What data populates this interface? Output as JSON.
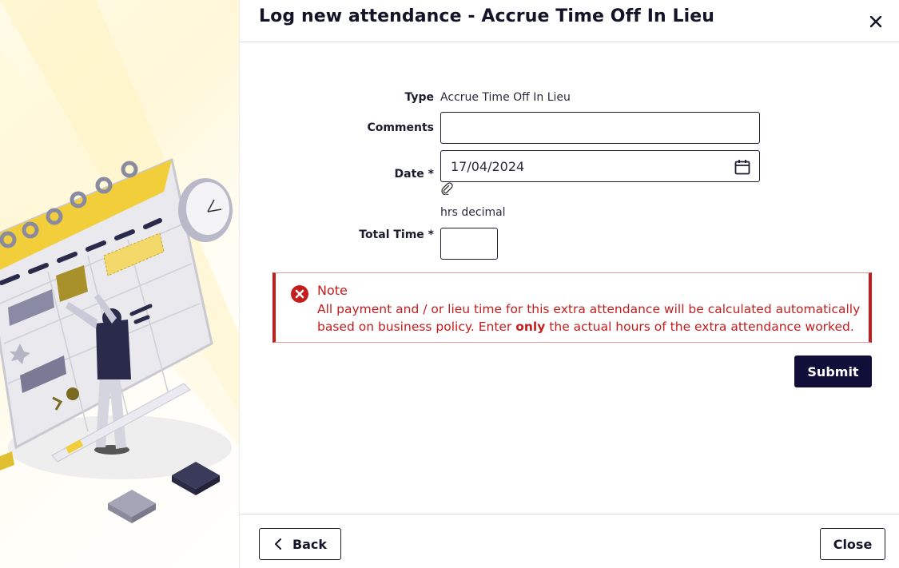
{
  "dialog": {
    "title": "Log new attendance - Accrue Time Off In Lieu"
  },
  "form": {
    "type_label": "Type",
    "type_value": "Accrue Time Off In Lieu",
    "comments_label": "Comments",
    "comments_value": "",
    "date_label": "Date *",
    "date_value": "17/04/2024",
    "unit_hint": "hrs decimal",
    "total_time_label": "Total Time *",
    "total_time_value": ""
  },
  "note": {
    "title": "Note",
    "text_before": "All payment and / or lieu time for this extra attendance will be calculated automatically based on business policy. Enter ",
    "text_bold": "only",
    "text_after": " the actual hours of the extra attendance worked."
  },
  "actions": {
    "submit_label": "Submit",
    "back_label": "Back",
    "close_label": "Close"
  },
  "icons": {
    "close": "close-icon",
    "calendar": "calendar-icon",
    "attachment": "paperclip-icon",
    "error": "error-circle-icon",
    "back": "chevron-left-icon"
  },
  "colors": {
    "primary": "#0f0f3a",
    "error": "#c31d1d",
    "accent_yellow": "#f2cf3a"
  }
}
